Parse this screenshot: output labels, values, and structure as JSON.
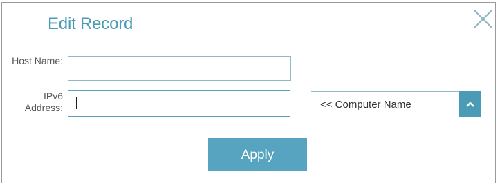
{
  "dialog": {
    "title": "Edit Record",
    "close_icon": "close-icon"
  },
  "form": {
    "host_name_label": "Host Name:",
    "host_name_value": "",
    "ipv6_label": "IPv6 Address:",
    "ipv6_value": "",
    "computer_select": {
      "selected": "<< Computer Name",
      "toggle_icon": "chevron-up-icon"
    }
  },
  "actions": {
    "apply_label": "Apply"
  },
  "colors": {
    "accent": "#4a9bb5",
    "button": "#56a4c0",
    "label": "#555555"
  }
}
